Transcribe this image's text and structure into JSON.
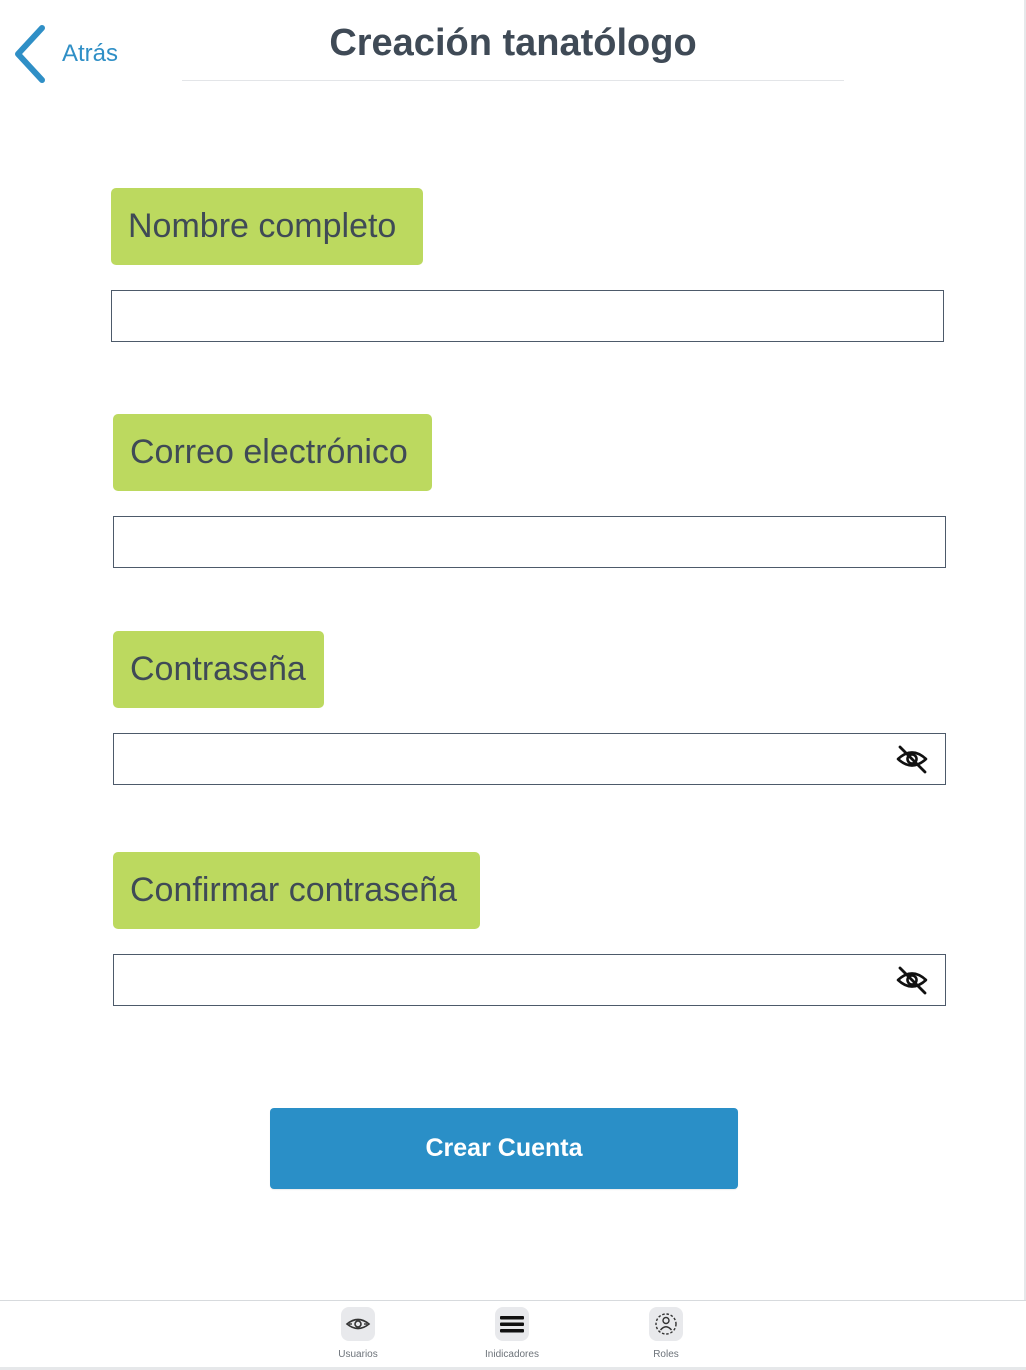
{
  "header": {
    "back_label": "Atrás",
    "title": "Creación tanatólogo"
  },
  "form": {
    "full_name": {
      "label": "Nombre completo",
      "value": ""
    },
    "email": {
      "label": "Correo electrónico",
      "value": ""
    },
    "password": {
      "label": "Contraseña",
      "value": "",
      "visibility_icon": "eye-off-icon"
    },
    "confirm_password": {
      "label": "Confirmar contraseña",
      "value": "",
      "visibility_icon": "eye-off-icon"
    }
  },
  "submit": {
    "label": "Crear Cuenta"
  },
  "tabbar": {
    "items": [
      {
        "label": "Usuarios",
        "icon": "eye-icon"
      },
      {
        "label": "Inidicadores",
        "icon": "menu-icon"
      },
      {
        "label": "Roles",
        "icon": "roles-icon"
      }
    ]
  },
  "colors": {
    "accent": "#2a8fc7",
    "label_background": "#bcd95f",
    "title_text": "#3f4a56",
    "back_link": "#2f8fc6"
  }
}
